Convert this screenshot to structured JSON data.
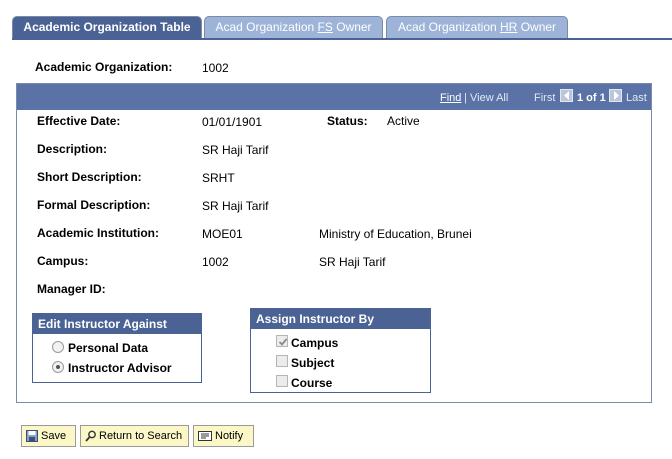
{
  "tabs": [
    {
      "label": "Academic Organization Table",
      "active": true
    },
    {
      "label_pre": "Acad Organization ",
      "label_key": "FS",
      "label_post": " Owner",
      "active": false
    },
    {
      "label_pre": "Acad Organization ",
      "label_key": "HR",
      "label_post": " Owner",
      "active": false
    }
  ],
  "header": {
    "label": "Academic Organization:",
    "value": "1002"
  },
  "grid_nav": {
    "find": "Find",
    "separator": "|",
    "view_all": "View All",
    "first": "First",
    "range": "1 of 1",
    "last": "Last"
  },
  "fields": {
    "effective_date": {
      "label": "Effective Date:",
      "value": "01/01/1901"
    },
    "status": {
      "label": "Status:",
      "value": "Active"
    },
    "description": {
      "label": "Description:",
      "value": "SR Haji Tarif"
    },
    "short_description": {
      "label": "Short Description:",
      "value": "SRHT"
    },
    "formal_description": {
      "label": "Formal Description:",
      "value": "SR Haji Tarif"
    },
    "academic_institution": {
      "label": "Academic Institution:",
      "value": "MOE01",
      "desc": "Ministry of Education, Brunei"
    },
    "campus": {
      "label": "Campus:",
      "value": "1002",
      "desc": "SR Haji Tarif"
    },
    "manager_id": {
      "label": "Manager ID:",
      "value": ""
    }
  },
  "edit_instructor": {
    "title": "Edit Instructor Against",
    "options": [
      {
        "label": "Personal Data",
        "selected": false
      },
      {
        "label": "Instructor Advisor",
        "selected": true
      }
    ]
  },
  "assign_instructor": {
    "title": "Assign Instructor By",
    "options": [
      {
        "label": "Campus",
        "checked": true
      },
      {
        "label": "Subject",
        "checked": false
      },
      {
        "label": "Course",
        "checked": false
      }
    ]
  },
  "toolbar": {
    "save": "Save",
    "return_to_search": "Return to Search",
    "notify": "Notify"
  },
  "colors": {
    "tab_active": "#4a6294",
    "tab_inactive": "#9db3d8",
    "header_bar": "#5a72a6",
    "button_bg": "#fbf7c7"
  }
}
